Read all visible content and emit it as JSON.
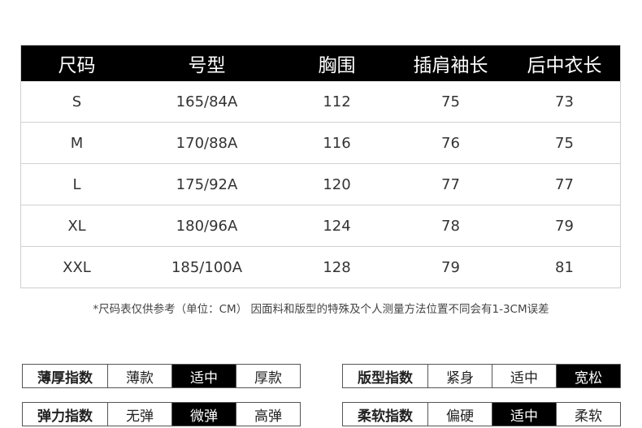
{
  "size_table": {
    "headers": [
      "尺码",
      "号型",
      "胸围",
      "插肩袖长",
      "后中衣长"
    ],
    "rows": [
      [
        "S",
        "165/84A",
        "112",
        "75",
        "73"
      ],
      [
        "M",
        "170/88A",
        "116",
        "76",
        "75"
      ],
      [
        "L",
        "175/92A",
        "120",
        "77",
        "77"
      ],
      [
        "XL",
        "180/96A",
        "124",
        "78",
        "79"
      ],
      [
        "XXL",
        "185/100A",
        "128",
        "79",
        "81"
      ]
    ]
  },
  "note": "*尺码表仅供参考（单位：CM） 因面料和版型的特殊及个人测量方法位置不同会有1-3CM误差",
  "indices": {
    "thickness": {
      "label": "薄厚指数",
      "options": [
        "薄款",
        "适中",
        "厚款"
      ],
      "selected": "适中"
    },
    "fit": {
      "label": "版型指数",
      "options": [
        "紧身",
        "适中",
        "宽松"
      ],
      "selected": "宽松"
    },
    "elasticity": {
      "label": "弹力指数",
      "options": [
        "无弹",
        "微弹",
        "高弹"
      ],
      "selected": "微弹"
    },
    "softness": {
      "label": "柔软指数",
      "options": [
        "偏硬",
        "适中",
        "柔软"
      ],
      "selected": "适中"
    }
  },
  "colors": {
    "header_bg": "#000000",
    "header_text": "#ffffff",
    "active_bg": "#000000",
    "active_text": "#ffffff"
  }
}
